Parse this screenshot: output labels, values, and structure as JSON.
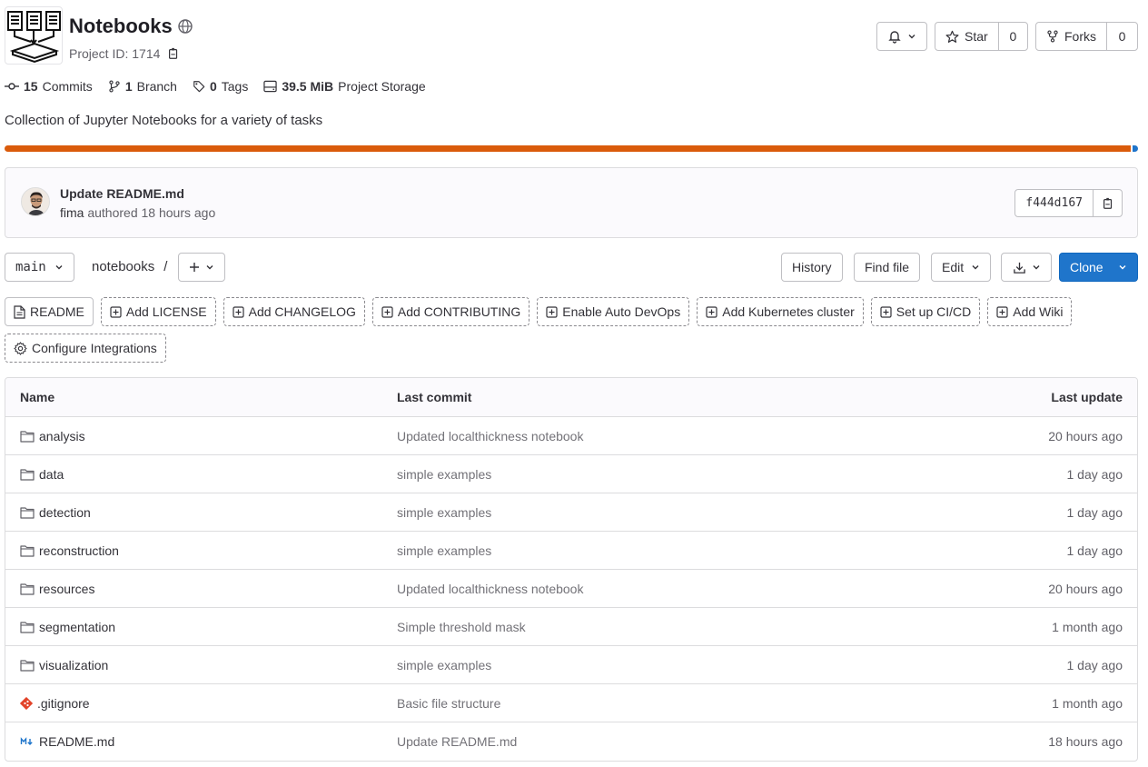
{
  "project": {
    "title": "Notebooks",
    "id_text": "Project ID: 1714"
  },
  "actions": {
    "star_label": "Star",
    "star_count": "0",
    "forks_label": "Forks",
    "forks_count": "0"
  },
  "stats": {
    "commits_count": "15",
    "commits_label": "Commits",
    "branch_count": "1",
    "branch_label": "Branch",
    "tags_count": "0",
    "tags_label": "Tags",
    "storage_size": "39.5 MiB",
    "storage_label": "Project Storage"
  },
  "description": "Collection of Jupyter Notebooks for a variety of tasks",
  "language_bar": {
    "colors": [
      "#da5b0b",
      "#1f75cb"
    ],
    "shares": [
      0.995,
      0.005
    ]
  },
  "last_commit": {
    "title": "Update README.md",
    "author": "fima",
    "meta": "authored 18 hours ago",
    "sha": "f444d167"
  },
  "toolbar": {
    "branch": "main",
    "path_root": "notebooks",
    "path_sep": "/",
    "history": "History",
    "find_file": "Find file",
    "edit": "Edit",
    "clone": "Clone"
  },
  "quick_actions": {
    "readme": "README",
    "add_license": "Add LICENSE",
    "add_changelog": "Add CHANGELOG",
    "add_contributing": "Add CONTRIBUTING",
    "auto_devops": "Enable Auto DevOps",
    "k8s": "Add Kubernetes cluster",
    "cicd": "Set up CI/CD",
    "wiki": "Add Wiki",
    "integrations": "Configure Integrations"
  },
  "table": {
    "headers": {
      "name": "Name",
      "commit": "Last commit",
      "update": "Last update"
    },
    "rows": [
      {
        "name": "analysis",
        "commit": "Updated localthickness notebook",
        "update": "20 hours ago",
        "icon": "folder-icon"
      },
      {
        "name": "data",
        "commit": "simple examples",
        "update": "1 day ago",
        "icon": "folder-icon"
      },
      {
        "name": "detection",
        "commit": "simple examples",
        "update": "1 day ago",
        "icon": "folder-icon"
      },
      {
        "name": "reconstruction",
        "commit": "simple examples",
        "update": "1 day ago",
        "icon": "folder-icon"
      },
      {
        "name": "resources",
        "commit": "Updated localthickness notebook",
        "update": "20 hours ago",
        "icon": "folder-icon"
      },
      {
        "name": "segmentation",
        "commit": "Simple threshold mask",
        "update": "1 month ago",
        "icon": "folder-icon"
      },
      {
        "name": "visualization",
        "commit": "simple examples",
        "update": "1 day ago",
        "icon": "folder-icon"
      },
      {
        "name": ".gitignore",
        "commit": "Basic file structure",
        "update": "1 month ago",
        "icon": "git-icon"
      },
      {
        "name": "README.md",
        "commit": "Update README.md",
        "update": "18 hours ago",
        "icon": "markdown-icon"
      }
    ]
  }
}
